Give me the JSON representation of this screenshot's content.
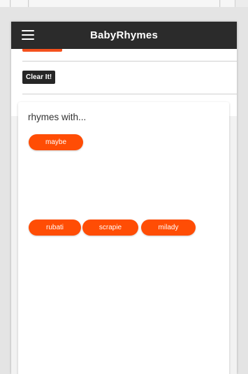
{
  "app": {
    "title": "BabyRhymes"
  },
  "controls": {
    "clear_label": "Clear It!"
  },
  "results": {
    "heading": "rhymes with...",
    "query_word": "maybe",
    "rhymes": [
      "rubati",
      "scrapie",
      "milady"
    ]
  },
  "colors": {
    "appbar": "#2b2b2b",
    "accent": "#ff4d05",
    "clear_button": "#262626"
  },
  "icons": {
    "menu": "hamburger-menu-icon"
  }
}
